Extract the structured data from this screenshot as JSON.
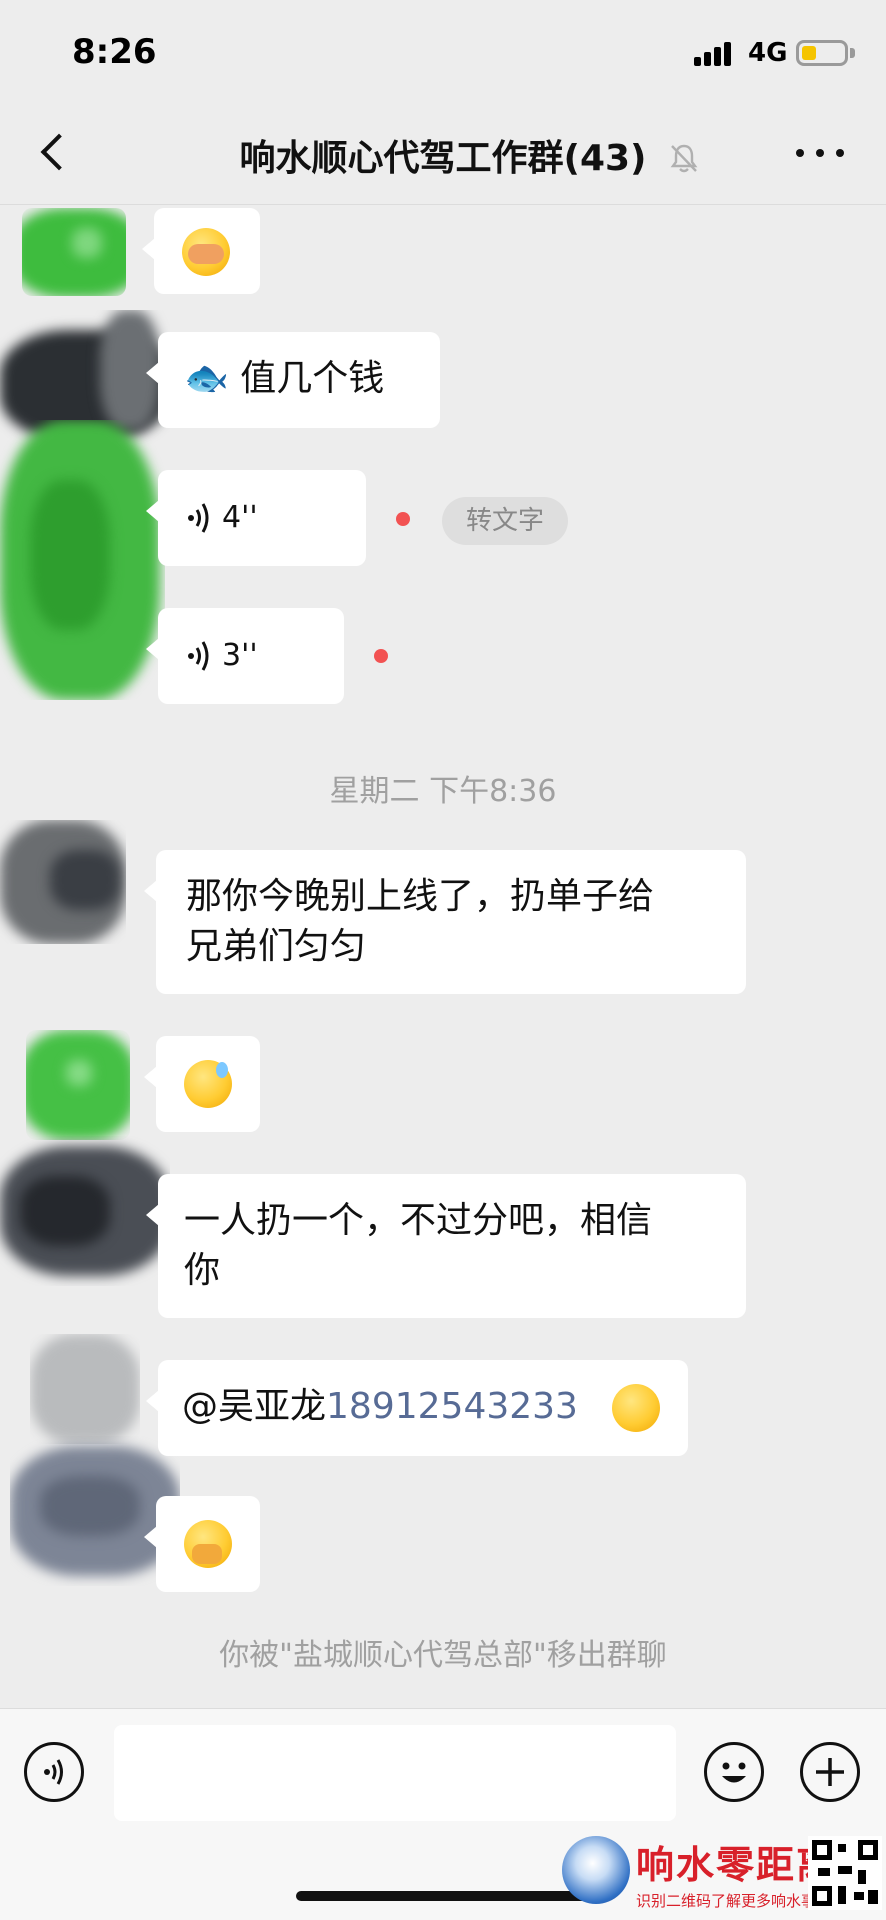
{
  "status_bar": {
    "time": "8:26",
    "network": "4G",
    "battery_level": 0.35
  },
  "nav": {
    "title": "响水顺心代驾工作群(43)",
    "icons": [
      "back-chevron-icon",
      "bell-muted-icon",
      "more-dots-icon"
    ]
  },
  "messages": {
    "m1": {
      "type": "emoji",
      "emoji": "facepalm"
    },
    "m2": {
      "type": "text",
      "text": "🐟 值几个钱"
    },
    "m3": {
      "type": "voice",
      "duration": "4''",
      "unread": true,
      "to_text_label": "转文字"
    },
    "m4": {
      "type": "voice",
      "duration": "3''",
      "unread": true
    },
    "timestamp": "星期二 下午8:36",
    "m5": {
      "type": "text",
      "line1": "那你今晚别上线了，扔单子给",
      "line2": "兄弟们匀匀"
    },
    "m6": {
      "type": "emoji",
      "emoji": "sweat-smile"
    },
    "m7": {
      "type": "text",
      "line1": "一人扔一个，不过分吧，相信",
      "line2": "你"
    },
    "m8": {
      "type": "mention",
      "prefix": "@吴亚龙",
      "phone": "18912543233",
      "emoji": "hugging"
    },
    "m9": {
      "type": "emoji",
      "emoji": "hand-over-mouth"
    },
    "system_notice": "你被\"盐城顺心代驾总部\"移出群聊"
  },
  "input_bar": {
    "icons": [
      "voice-mode-icon",
      "emoji-icon",
      "add-icon"
    ],
    "input_value": ""
  },
  "watermark": {
    "title": "响水零距离",
    "subtitle": "识别二维码了解更多响水事"
  },
  "colors": {
    "background": "#ededed",
    "bubble": "#ffffff",
    "unread_dot": "#f25252",
    "link": "#576b95",
    "watermark_red": "#d8202a"
  }
}
